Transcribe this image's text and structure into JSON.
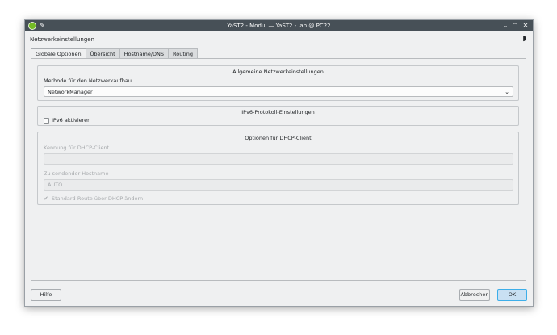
{
  "window": {
    "title": "YaST2 - Modul — YaST2 - lan @ PC22"
  },
  "dialog": {
    "title": "Netzwerkeinstellungen"
  },
  "tabs": [
    {
      "label": "Globale Optionen",
      "active": true
    },
    {
      "label": "Übersicht",
      "active": false
    },
    {
      "label": "Hostname/DNS",
      "active": false
    },
    {
      "label": "Routing",
      "active": false
    }
  ],
  "general": {
    "title": "Allgemeine Netzwerkeinstellungen",
    "method_label": "Methode für den Netzwerkaufbau",
    "method_value": "NetworkManager"
  },
  "ipv6": {
    "title": "IPv6-Protokoll-Einstellungen",
    "enable_label": "IPv6 aktivieren",
    "enabled": false
  },
  "dhcp": {
    "title": "Optionen für DHCP-Client",
    "client_id_label": "Kennung für DHCP-Client",
    "client_id_value": "",
    "hostname_label": "Zu sendender Hostname",
    "hostname_value": "AUTO",
    "default_route_label": "Standard-Route über DHCP ändern",
    "default_route_checked": true
  },
  "buttons": {
    "help": "Hilfe",
    "cancel": "Abbrechen",
    "ok": "OK"
  },
  "colors": {
    "titlebar": "#475057",
    "window_bg": "#eff0f1",
    "accent": "#3daee9"
  }
}
